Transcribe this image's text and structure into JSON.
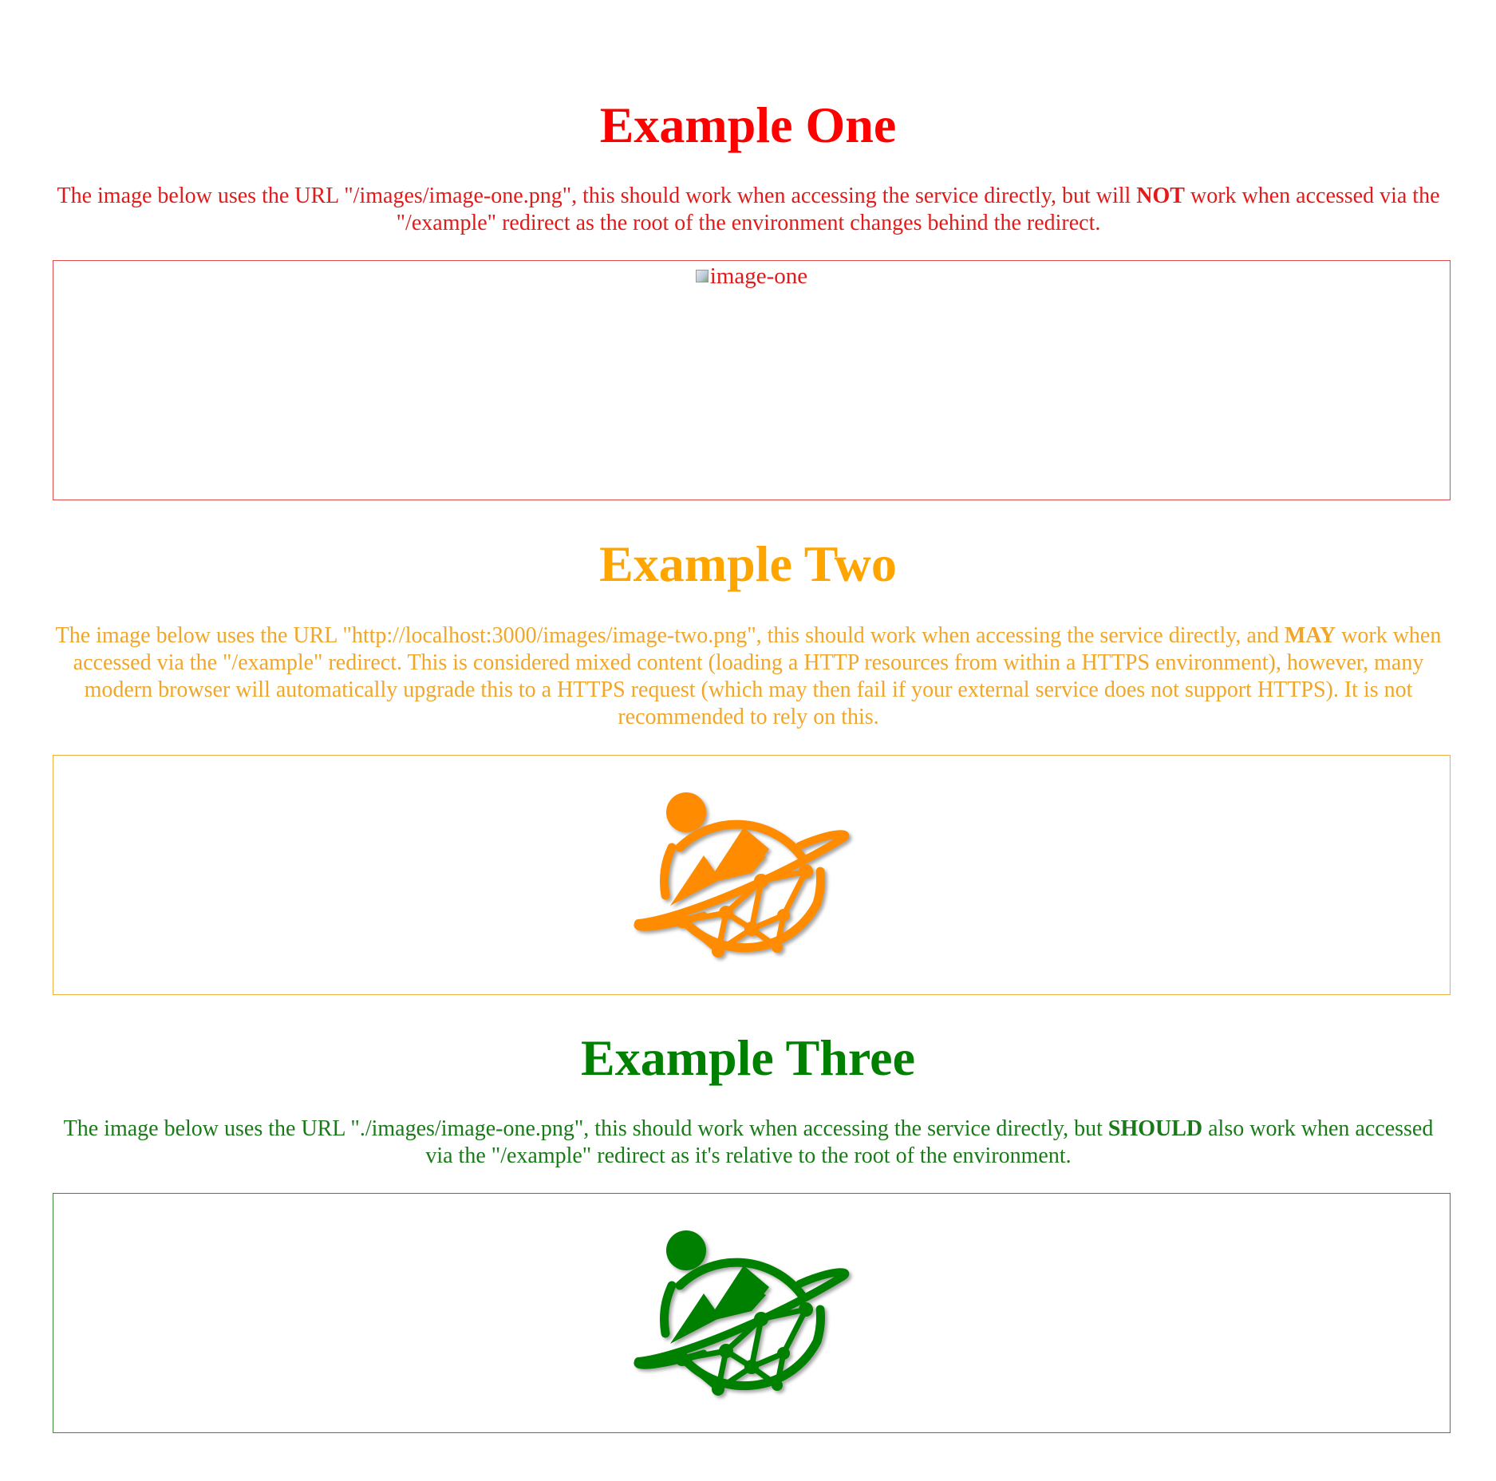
{
  "colors": {
    "red": "#ff0000",
    "red_text": "#e31a1a",
    "orange": "#ffa500",
    "orange_text": "#f0a62a",
    "orange_logo": "#ff8c00",
    "green": "#008000",
    "green_text": "#1a7a1a",
    "box_red": "#e04b4b",
    "box_orange": "#f0b040",
    "box_green": "#3a8a3a"
  },
  "example_one": {
    "title": "Example One",
    "text_before": "The image below uses the URL \"/images/image-one.png\", this should work when accessing the service directly, but will ",
    "emphasis": "NOT",
    "text_after": " work when accessed via the \"/example\" redirect as the root of the environment changes behind the redirect.",
    "image_alt": "image-one"
  },
  "example_two": {
    "title": "Example Two",
    "text_before": "The image below uses the URL \"http://localhost:3000/images/image-two.png\", this should work when accessing the service directly, and ",
    "emphasis": "MAY",
    "text_after": " work when accessed via the \"/example\" redirect. This is considered mixed content (loading a HTTP resources from within a HTTPS environment), however, many modern browser will automatically upgrade this to a HTTPS request (which may then fail if your external service does not support HTTPS). It is not recommended to rely on this.",
    "image_icon": "planet-mountains-network-logo-icon"
  },
  "example_three": {
    "title": "Example Three",
    "text_before": "The image below uses the URL \"./images/image-one.png\", this should work when accessing the service directly, but ",
    "emphasis": "SHOULD",
    "text_after": " also work when accessed via the \"/example\" redirect as it's relative to the root of the environment.",
    "image_icon": "planet-mountains-network-logo-icon"
  }
}
